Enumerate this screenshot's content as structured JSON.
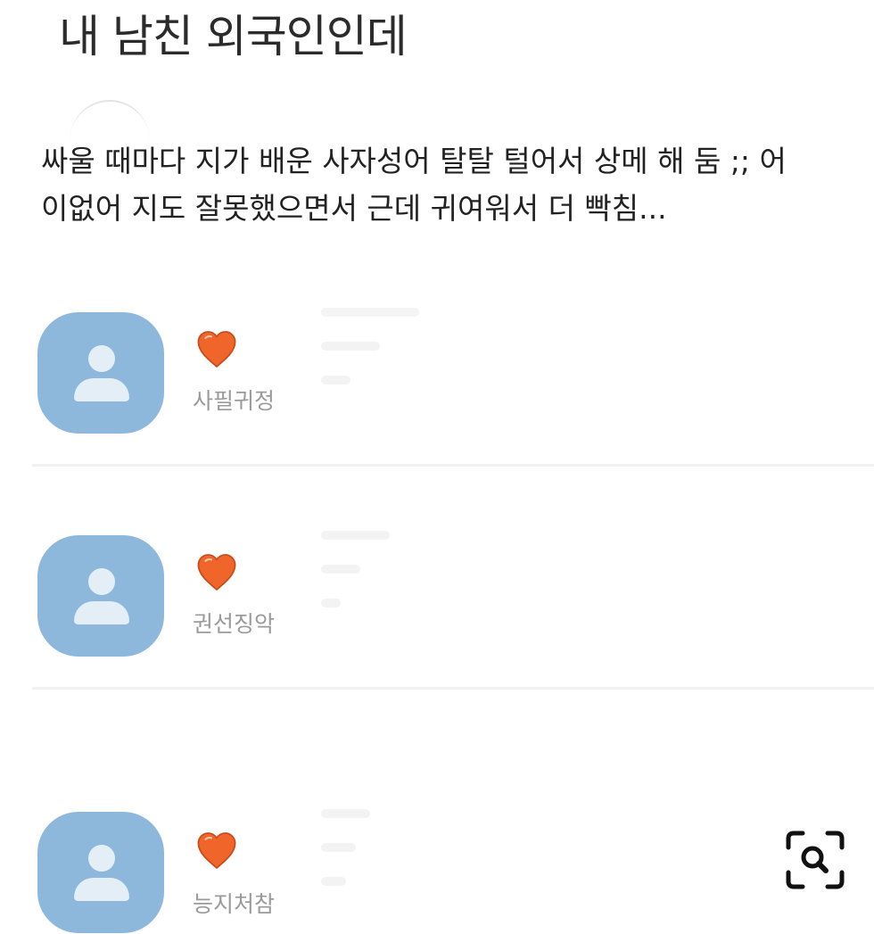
{
  "post": {
    "title": "내 남친 외국인인데",
    "body_line_1": "싸울 때마다 지가 배운 사자성어 탈탈 털어서 상메 해 둠 ;; 어",
    "body_line_2": "이없어 지도 잘못했으면서 근데 귀여워서 더 빡침..."
  },
  "comments": [
    {
      "emoji": "heart",
      "nickname": "사필귀정"
    },
    {
      "emoji": "heart",
      "nickname": "권선징악"
    },
    {
      "emoji": "heart",
      "nickname": "능지처참"
    }
  ],
  "colors": {
    "avatar": "#8db8dc",
    "heart": "#f0662a",
    "nickname": "#9a9a9a"
  },
  "icons": {
    "avatar": "default-user-icon",
    "reaction": "orange-heart-icon",
    "lens": "search-icon"
  }
}
